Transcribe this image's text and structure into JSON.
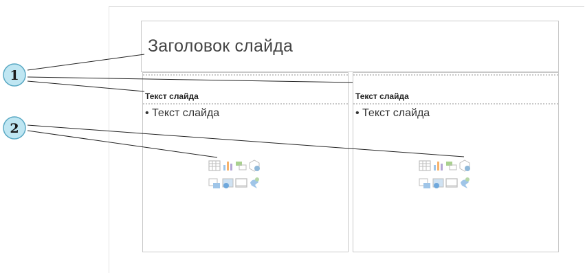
{
  "slide": {
    "title_placeholder": "Заголовок слайда",
    "columns": [
      {
        "heading": "Текст слайда",
        "body_bullet": "• Текст слайда"
      },
      {
        "heading": "Текст слайда",
        "body_bullet": "• Текст слайда"
      }
    ],
    "content_icons": [
      "table-icon",
      "chart-icon",
      "smartart-icon",
      "3d-model-icon",
      "picture-icon",
      "online-picture-icon",
      "video-icon",
      "icons-icon"
    ]
  },
  "callouts": [
    {
      "label": "1"
    },
    {
      "label": "2"
    }
  ],
  "colors": {
    "callout_fill": "#bfe6f2",
    "callout_stroke": "#5aa9c4",
    "placeholder_border": "#c8c8c8"
  }
}
